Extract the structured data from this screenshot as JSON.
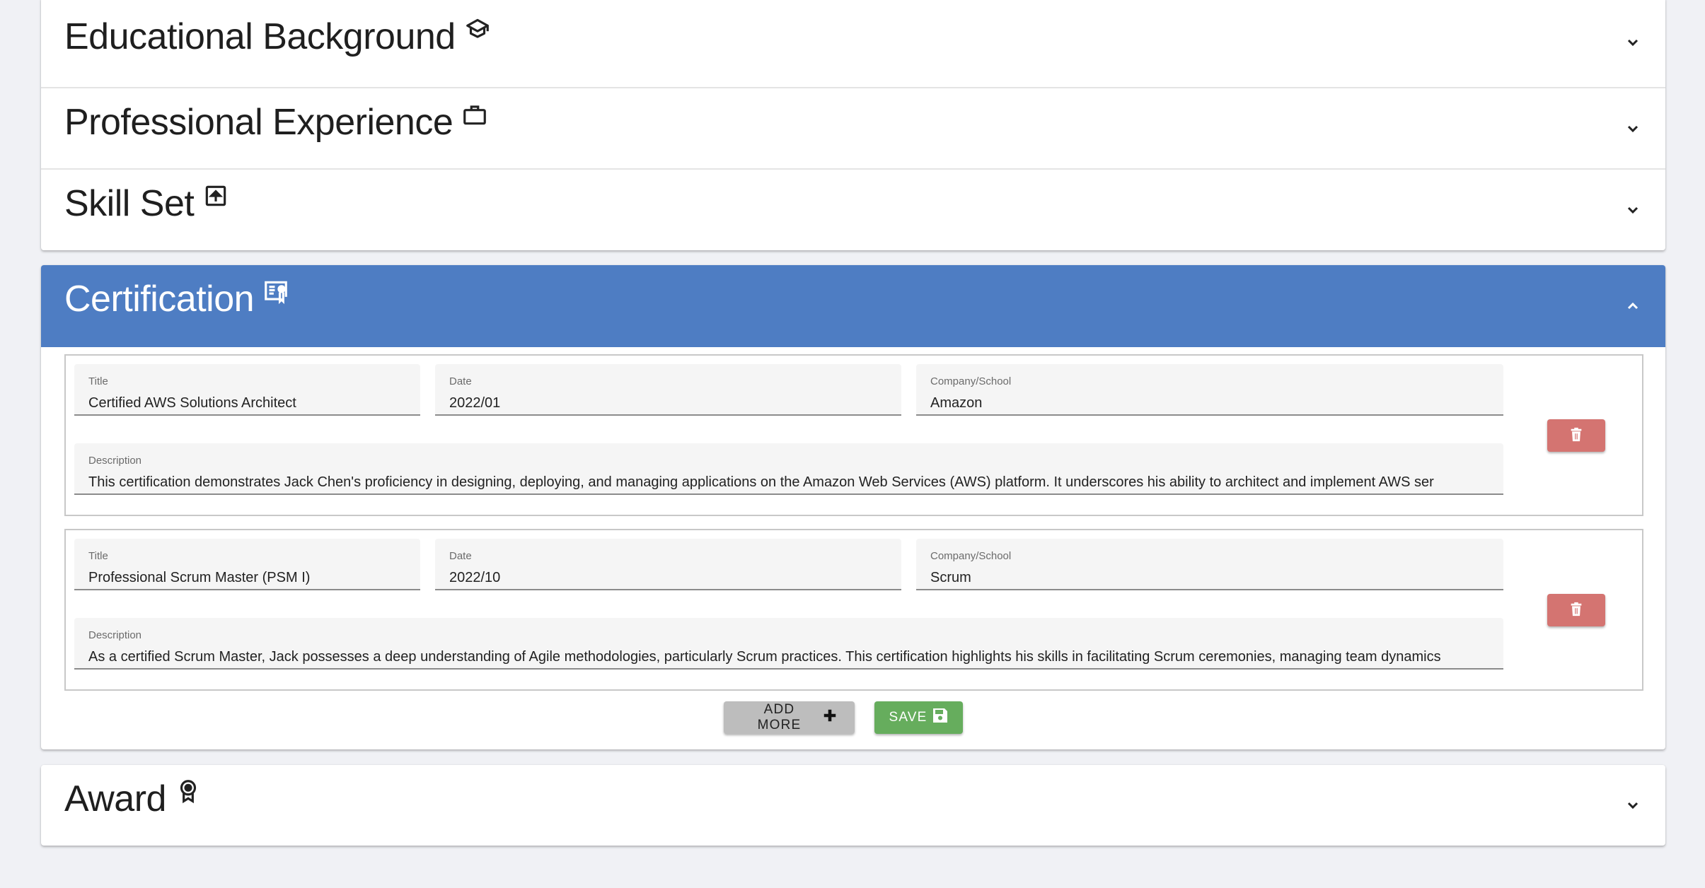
{
  "colors": {
    "page_bg": "#f0f1f5",
    "active_header": "#4e7dc3",
    "delete_button": "#d47471",
    "save_button": "#66ad5d",
    "add_button": "#bdbdbd"
  },
  "sections": {
    "education": {
      "title": "Educational Background",
      "icon": "graduation-cap-icon",
      "expanded": false
    },
    "experience": {
      "title": "Professional Experience",
      "icon": "briefcase-icon",
      "expanded": false
    },
    "skills": {
      "title": "Skill Set",
      "icon": "square-arrow-up-icon",
      "expanded": false
    },
    "certification": {
      "title": "Certification",
      "icon": "certificate-icon",
      "expanded": true
    },
    "award": {
      "title": "Award",
      "icon": "award-ribbon-icon",
      "expanded": false
    }
  },
  "certification": {
    "labels": {
      "title": "Title",
      "date": "Date",
      "company": "Company/School",
      "description": "Description"
    },
    "items": [
      {
        "title": "Certified AWS Solutions Architect",
        "date": "2022/01",
        "company": "Amazon",
        "description": "This certification demonstrates Jack Chen's proficiency in designing, deploying, and managing applications on the Amazon Web Services (AWS) platform. It underscores his ability to architect and implement AWS ser"
      },
      {
        "title": "Professional Scrum Master (PSM I)",
        "date": "2022/10",
        "company": "Scrum",
        "description": "As a certified Scrum Master, Jack possesses a deep understanding of Agile methodologies, particularly Scrum practices. This certification highlights his skills in facilitating Scrum ceremonies, managing team dynamics"
      }
    ],
    "add_more_label": "ADD MORE",
    "save_label": "SAVE"
  }
}
